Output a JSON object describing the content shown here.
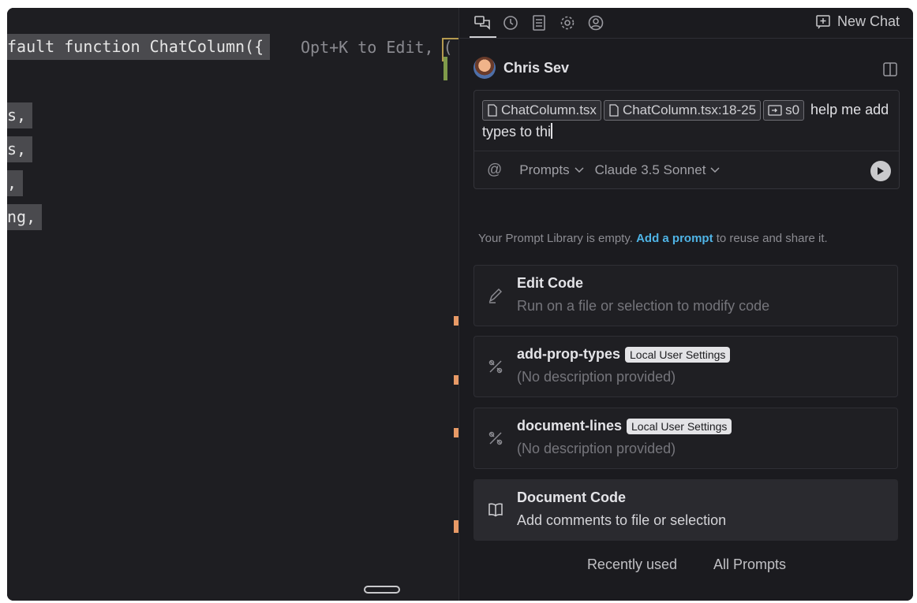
{
  "editor": {
    "lines": [
      {
        "text": "fault function ChatColumn({"
      },
      {
        "text": "s,"
      },
      {
        "text": "s,"
      },
      {
        "text": ","
      },
      {
        "text": "ng,"
      }
    ],
    "inline_hint": "Opt+K to Edit, ("
  },
  "panel": {
    "tabs": [
      {
        "name": "chat-icon"
      },
      {
        "name": "history-icon"
      },
      {
        "name": "notes-icon"
      },
      {
        "name": "settings-icon"
      },
      {
        "name": "account-icon"
      }
    ],
    "new_chat_label": "New Chat",
    "user_name": "Chris Sev",
    "composer": {
      "chips": [
        {
          "label": "ChatColumn.tsx",
          "icon": "file-icon"
        },
        {
          "label": "ChatColumn.tsx:18-25",
          "icon": "file-icon"
        },
        {
          "label": "s0",
          "icon": "folder-icon"
        }
      ],
      "text": " help me add types to thi",
      "at_symbol": "@",
      "prompts_label": "Prompts",
      "model_label": "Claude 3.5 Sonnet"
    },
    "library_note": {
      "before": "Your Prompt Library is empty. ",
      "link": "Add a prompt",
      "after": " to reuse and share it."
    },
    "cards": [
      {
        "title": "Edit Code",
        "description": "Run on a file or selection to modify code",
        "icon": "pencil-icon",
        "badge": ""
      },
      {
        "title": "add-prop-types",
        "description": "(No description provided)",
        "icon": "tools-icon",
        "badge": "Local User Settings"
      },
      {
        "title": "document-lines",
        "description": "(No description provided)",
        "icon": "tools-icon",
        "badge": "Local User Settings"
      },
      {
        "title": "Document Code",
        "description": "Add comments to file or selection",
        "icon": "book-icon",
        "badge": ""
      }
    ],
    "bottom_links": {
      "recent": "Recently used",
      "all": "All Prompts"
    }
  },
  "colors": {
    "link": "#4fb4e6",
    "editor_bg": "#1e1e22",
    "panel_bg": "#1b1b1f",
    "selection": "#4a4a4e",
    "marker_orange": "#e89a66",
    "marker_green": "#7f9a4a"
  }
}
